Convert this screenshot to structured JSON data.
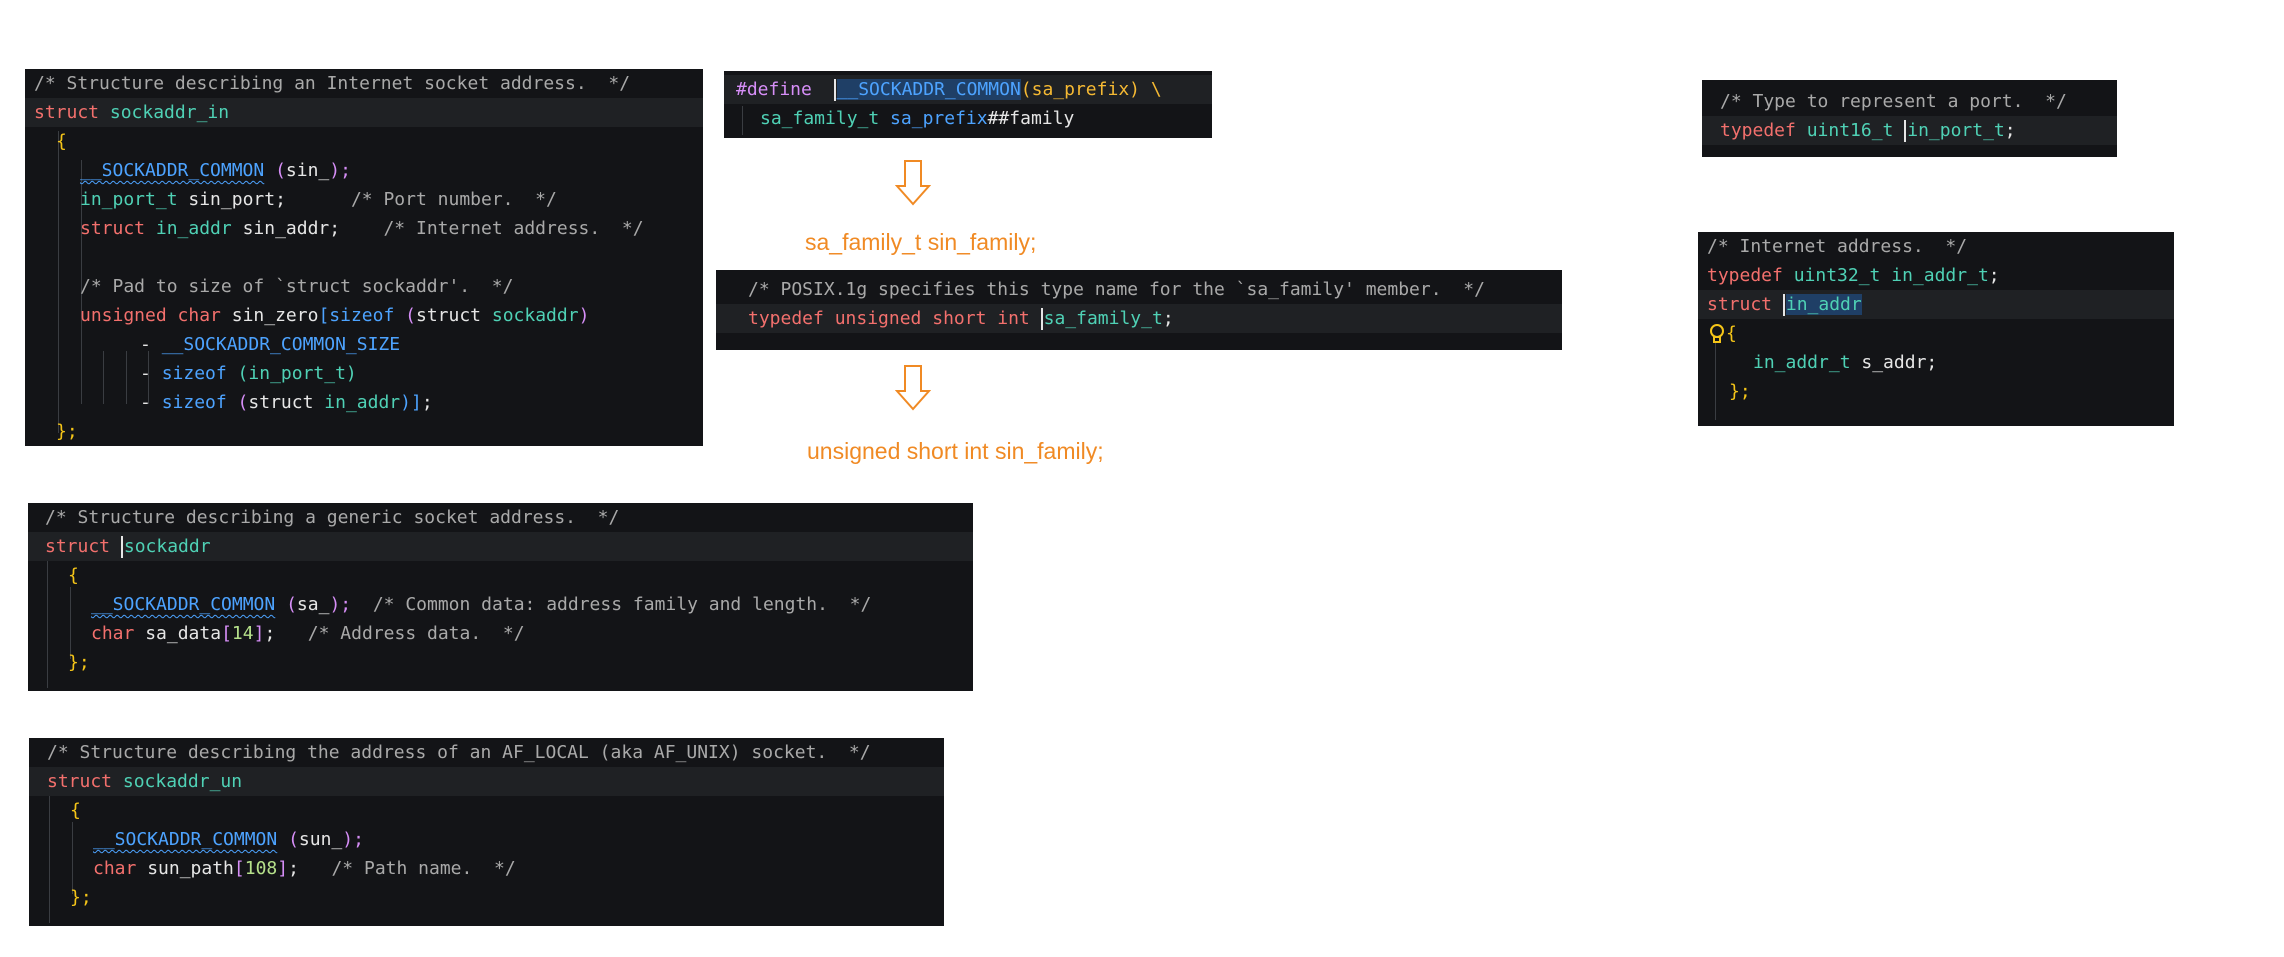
{
  "sockaddr_in": {
    "comment": "/* Structure describing an Internet socket address.  */",
    "kw_struct": "struct",
    "name": "sockaddr_in",
    "open_brace": "{",
    "macro": "__SOCKADDR_COMMON",
    "macro_arg_open": " (",
    "macro_arg": "sin_",
    "macro_arg_close": ");",
    "port_type": "in_port_t",
    "port_field": " sin_port;",
    "port_comment": "/* Port number.  */",
    "addr_kw": "struct",
    "addr_type": "in_addr",
    "addr_field": " sin_addr;",
    "addr_comment": "/* Internet address.  */",
    "pad_comment": "/* Pad to size of `struct sockaddr'.  */",
    "zero_kw": "unsigned char",
    "zero_field": " sin_zero",
    "zero_bracket": "[",
    "sizeof": "sizeof",
    "sizeof_open": " (",
    "sizeof_struct": "struct",
    "sizeof_type": " sockaddr",
    "sizeof_close": ")",
    "minus1": "- ",
    "common_size": "__SOCKADDR_COMMON_SIZE",
    "minus2": "- ",
    "sizeof2": "sizeof",
    "sizeof2_arg": " (in_port_t)",
    "minus3": "- ",
    "sizeof3": "sizeof",
    "sizeof3_open": " (",
    "sizeof3_struct": "struct",
    "sizeof3_type": " in_addr",
    "sizeof3_close": ")]",
    "sizeof3_end": ";",
    "close_brace": "};"
  },
  "define": {
    "directive": "#define",
    "macro": "__SOCKADDR_COMMON",
    "params": "(sa_prefix) \\",
    "type": "sa_family_t",
    "prefix": " sa_prefix",
    "concat": "##family"
  },
  "arrow1_note": "sa_family_t sin_family;",
  "posix": {
    "comment": "/* POSIX.1g specifies this type name for the `sa_family' member.  */",
    "kw": "typedef unsigned short int",
    "type": "sa_family_t",
    "end": ";"
  },
  "arrow2_note": "unsigned short int sin_family;",
  "port_type": {
    "comment": "/* Type to represent a port.  */",
    "kw": "typedef",
    "base": " uint16_t ",
    "name": "in_port_t",
    "end": ";"
  },
  "in_addr": {
    "comment": "/* Internet address.  */",
    "kw": "typedef",
    "base": " uint32_t",
    "alias": " in_addr_t",
    "end": ";",
    "kw_struct": "struct",
    "name": "in_addr",
    "open_brace": "{",
    "field_type": "in_addr_t",
    "field": " s_addr;",
    "close_brace": "};"
  },
  "sockaddr": {
    "comment": "/* Structure describing a generic socket address.  */",
    "kw_struct": "struct",
    "name": "sockaddr",
    "open_brace": "{",
    "macro": "__SOCKADDR_COMMON",
    "macro_arg_open": " (",
    "macro_arg": "sa_",
    "macro_arg_close": ");",
    "macro_comment": "/* Common data: address family and length.  */",
    "data_kw": "char",
    "data_field": " sa_data",
    "data_open": "[",
    "data_num": "14",
    "data_close": "]",
    "data_end": ";",
    "data_comment": "/* Address data.  */",
    "close_brace": "};"
  },
  "sockaddr_un": {
    "comment": "/* Structure describing the address of an AF_LOCAL (aka AF_UNIX) socket.  */",
    "kw_struct": "struct",
    "name": "sockaddr_un",
    "open_brace": "{",
    "macro": "__SOCKADDR_COMMON",
    "macro_arg_open": " (",
    "macro_arg": "sun_",
    "macro_arg_close": ");",
    "path_kw": "char",
    "path_field": " sun_path",
    "path_open": "[",
    "path_num": "108",
    "path_close": "]",
    "path_end": ";",
    "path_comment": "/* Path name.  */",
    "close_brace": "};"
  },
  "colors": {
    "panel_bg": "#131417",
    "keyword": "#f3706d",
    "type": "#4fd1b5",
    "function": "#4da3ff",
    "comment": "#a9a9a9",
    "annotation": "#f08a24"
  },
  "icons": {
    "arrow": "down-arrow-icon",
    "bulb": "lightbulb-icon"
  }
}
